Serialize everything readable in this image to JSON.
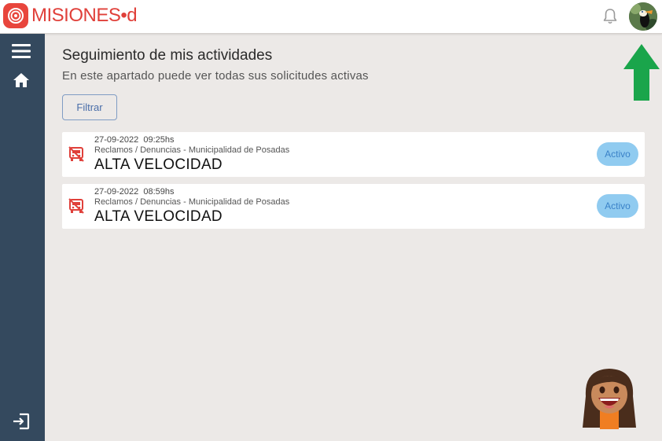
{
  "header": {
    "logo_text": "MISIONES•d"
  },
  "page": {
    "title": "Seguimiento de mis actividades",
    "subtitle": "En este apartado puede ver todas sus solicitudes activas",
    "filter_label": "Filtrar"
  },
  "activities": [
    {
      "datetime": "27-09-2022  09:25hs",
      "category": "Reclamos / Denuncias - Municipalidad de Posadas",
      "title": "ALTA VELOCIDAD",
      "status": "Activo"
    },
    {
      "datetime": "27-09-2022  08:59hs",
      "category": "Reclamos / Denuncias - Municipalidad de Posadas",
      "title": "ALTA VELOCIDAD",
      "status": "Activo"
    }
  ],
  "icons": {
    "sidebar": [
      "menu-icon",
      "home-icon",
      "logout-icon"
    ],
    "header": [
      "notification-bell-icon",
      "user-avatar"
    ],
    "card": "vehicle-icon"
  },
  "colors": {
    "brand": "#e0403a",
    "sidebar": "#34495e",
    "badge_bg": "#90cbf0",
    "badge_text": "#3a82c8",
    "arrow": "#1aa54b"
  }
}
